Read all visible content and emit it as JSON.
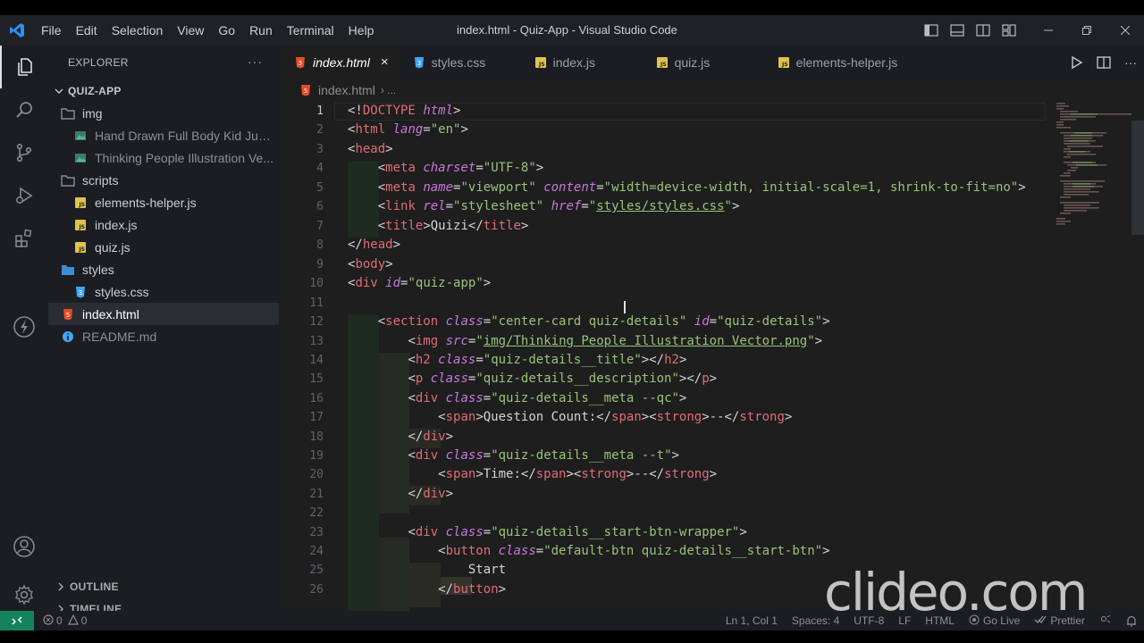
{
  "window": {
    "title": "index.html - Quiz-App - Visual Studio Code",
    "menu": [
      "File",
      "Edit",
      "Selection",
      "View",
      "Go",
      "Run",
      "Terminal",
      "Help"
    ]
  },
  "sidebar": {
    "header": "EXPLORER",
    "root": "QUIZ-APP",
    "tree": [
      {
        "label": "img",
        "icon": "folder-icon",
        "depth": 1
      },
      {
        "label": "Hand Drawn Full Body Kid Jum...",
        "icon": "image-icon",
        "depth": 2
      },
      {
        "label": "Thinking People Illustration Ve...",
        "icon": "image-icon",
        "depth": 2
      },
      {
        "label": "scripts",
        "icon": "folder-icon",
        "depth": 1
      },
      {
        "label": "elements-helper.js",
        "icon": "js-icon",
        "depth": 2
      },
      {
        "label": "index.js",
        "icon": "js-icon",
        "depth": 2
      },
      {
        "label": "quiz.js",
        "icon": "js-icon",
        "depth": 2
      },
      {
        "label": "styles",
        "icon": "folder-icon",
        "depth": 1
      },
      {
        "label": "styles.css",
        "icon": "css-icon",
        "depth": 2
      },
      {
        "label": "index.html",
        "icon": "html-icon",
        "depth": 1,
        "selected": true
      },
      {
        "label": "README.md",
        "icon": "info-icon",
        "depth": 1
      }
    ],
    "outline": "OUTLINE",
    "timeline": "TIMELINE"
  },
  "tabs": [
    {
      "label": "index.html",
      "icon": "html-icon",
      "active": true
    },
    {
      "label": "styles.css",
      "icon": "css-icon"
    },
    {
      "label": "index.js",
      "icon": "js-icon"
    },
    {
      "label": "quiz.js",
      "icon": "js-icon"
    },
    {
      "label": "elements-helper.js",
      "icon": "js-icon"
    }
  ],
  "tab_close": "×",
  "breadcrumb": {
    "file": "index.html",
    "more": "› ..."
  },
  "editor": {
    "lines": [
      {
        "n": "1"
      },
      {
        "n": "2"
      },
      {
        "n": "3"
      },
      {
        "n": "4"
      },
      {
        "n": "5"
      },
      {
        "n": "6"
      },
      {
        "n": "7"
      },
      {
        "n": "8"
      },
      {
        "n": "9"
      },
      {
        "n": "10"
      },
      {
        "n": "11"
      },
      {
        "n": "12"
      },
      {
        "n": "13"
      },
      {
        "n": "14"
      },
      {
        "n": "15"
      },
      {
        "n": "16"
      },
      {
        "n": "17"
      },
      {
        "n": "18"
      },
      {
        "n": "19"
      },
      {
        "n": "20"
      },
      {
        "n": "21"
      },
      {
        "n": "22"
      },
      {
        "n": "23"
      },
      {
        "n": "24"
      },
      {
        "n": "25"
      },
      {
        "n": "26"
      }
    ]
  },
  "watermark": "clideo.com",
  "statusbar": {
    "errors": "0",
    "warnings": "0",
    "position": "Ln 1, Col 1",
    "spaces": "Spaces: 4",
    "encoding": "UTF-8",
    "eol": "LF",
    "language": "HTML",
    "golive": "Go Live",
    "prettier": "Prettier"
  }
}
